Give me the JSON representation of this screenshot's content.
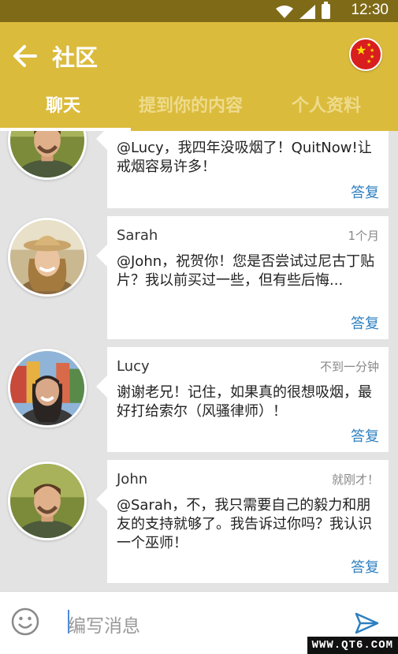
{
  "status_bar": {
    "time": "12:30",
    "icons": [
      "wifi-icon",
      "signal-icon",
      "battery-icon"
    ]
  },
  "app_bar": {
    "title": "社区",
    "back_icon": "arrow-left-icon",
    "language_flag": "china-flag-icon",
    "tabs": [
      {
        "label": "聊天",
        "active": true
      },
      {
        "label": "提到你的内容",
        "active": false
      },
      {
        "label": "个人资料",
        "active": false
      }
    ]
  },
  "messages": [
    {
      "name": "",
      "time": "",
      "text": "@Lucy，我四年没吸烟了！QuitNow!让戒烟容易许多！",
      "reply": "答复",
      "avatar": "john-avatar"
    },
    {
      "name": "Sarah",
      "time": "1个月",
      "text": "@John，祝贺你！您是否尝试过尼古丁贴片？我以前买过一些，但有些后悔...",
      "reply": "答复",
      "avatar": "sarah-avatar"
    },
    {
      "name": "Lucy",
      "time": "不到一分钟",
      "text": "谢谢老兄！记住，如果真的很想吸烟，最好打给索尔（风骚律师）！",
      "reply": "答复",
      "avatar": "lucy-avatar"
    },
    {
      "name": "John",
      "time": "就刚才！",
      "text": "@Sarah，不，我只需要自己的毅力和朋友的支持就够了。我告诉过你吗？我认识一个巫师！",
      "reply": "答复",
      "avatar": "john-avatar"
    }
  ],
  "composer": {
    "placeholder": "编写消息",
    "emoji_icon": "emoji-icon",
    "send_icon": "send-icon"
  },
  "watermark": "WWW.QT6.COM",
  "colors": {
    "status_bar": "#7f6a17",
    "app_bar": "#dbbb3c",
    "link": "#2d7fc0",
    "background": "#e3e3e3"
  }
}
